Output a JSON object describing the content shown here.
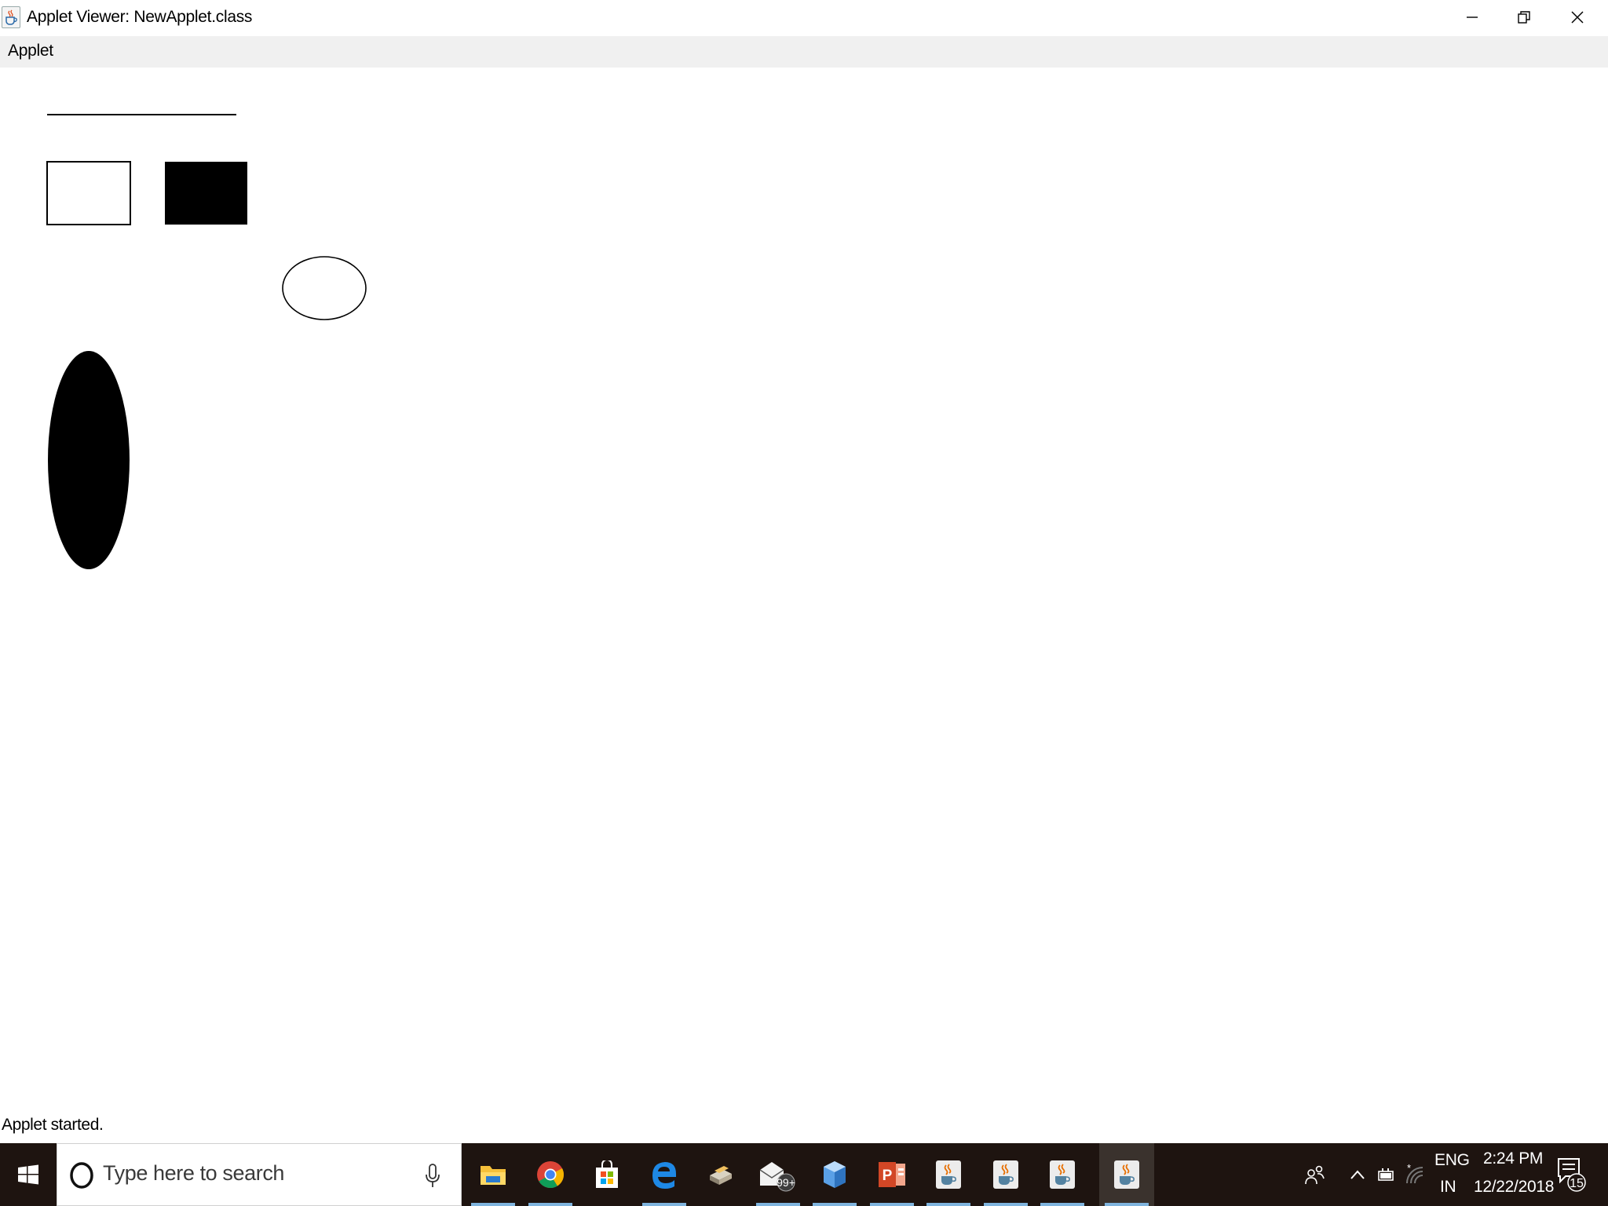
{
  "window": {
    "title": "Applet Viewer: NewApplet.class",
    "icon": "java-cup-icon",
    "controls": [
      "minimize-icon",
      "restore-icon",
      "close-icon"
    ]
  },
  "menu": {
    "items": [
      {
        "label": "Applet"
      }
    ]
  },
  "canvas": {
    "background": "#ffffff",
    "shapes": [
      "line",
      "rectangle-outline",
      "rectangle-filled",
      "oval-outline",
      "oval-filled"
    ]
  },
  "status": {
    "text": "Applet started."
  },
  "taskbar": {
    "background": "#1e1410",
    "search_placeholder": "Type here to search",
    "apps": [
      {
        "icon": "file-explorer-icon"
      },
      {
        "icon": "chrome-icon"
      },
      {
        "icon": "store-icon"
      },
      {
        "icon": "edge-icon"
      },
      {
        "icon": "printer-app-icon"
      },
      {
        "icon": "mail-icon",
        "badge": "99+"
      },
      {
        "icon": "cube-icon"
      },
      {
        "icon": "powerpoint-icon"
      },
      {
        "icon": "java-icon"
      },
      {
        "icon": "java-icon"
      },
      {
        "icon": "java-icon"
      },
      {
        "icon": "java-icon",
        "active": true
      }
    ],
    "tray": {
      "lang_line1": "ENG",
      "lang_line2": "IN",
      "time": "2:24 PM",
      "date": "12/22/2018",
      "notification_count": "15"
    }
  }
}
